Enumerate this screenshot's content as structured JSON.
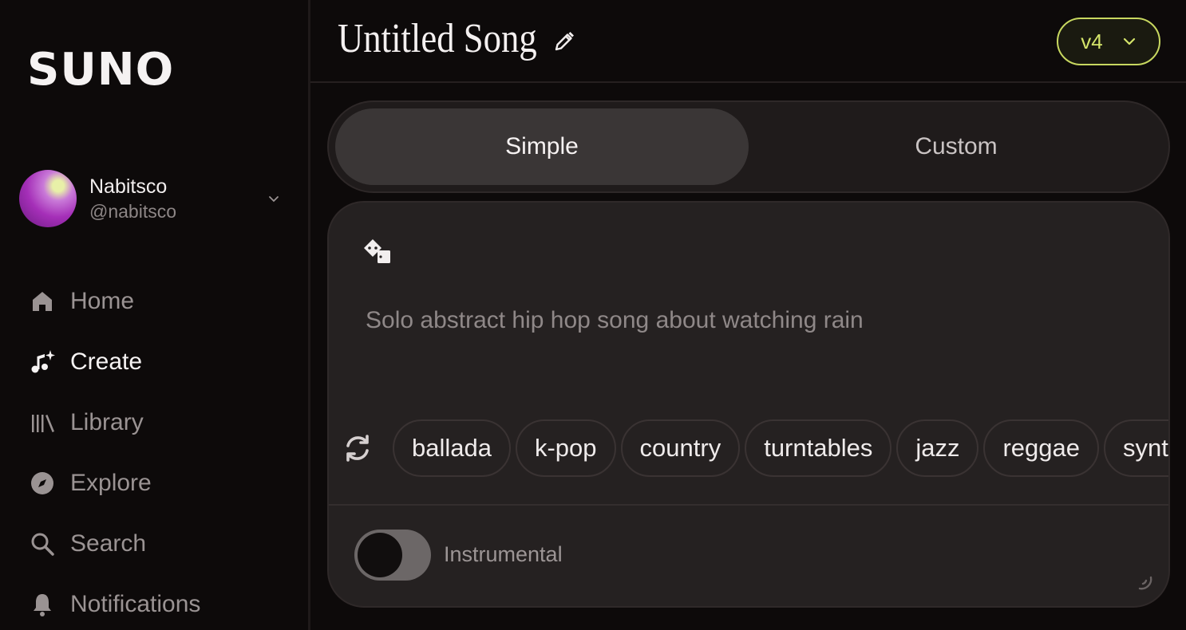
{
  "brand": {
    "logo_text": "SUNO"
  },
  "profile": {
    "name": "Nabitsco",
    "handle": "@nabitsco"
  },
  "nav": {
    "items": [
      {
        "label": "Home",
        "icon": "home-icon",
        "active": false
      },
      {
        "label": "Create",
        "icon": "music-sparkle-icon",
        "active": true
      },
      {
        "label": "Library",
        "icon": "library-icon",
        "active": false
      },
      {
        "label": "Explore",
        "icon": "compass-icon",
        "active": false
      },
      {
        "label": "Search",
        "icon": "search-icon",
        "active": false
      },
      {
        "label": "Notifications",
        "icon": "bell-icon",
        "active": false
      }
    ]
  },
  "header": {
    "title": "Untitled Song",
    "edit_icon": "pencil-icon",
    "version": "v4"
  },
  "mode": {
    "simple_label": "Simple",
    "custom_label": "Custom",
    "selected": "Simple"
  },
  "prompt": {
    "placeholder": "Solo abstract hip hop song about watching rain",
    "value": ""
  },
  "tags": [
    "ballada",
    "k-pop",
    "country",
    "turntables",
    "jazz",
    "reggae",
    "synth"
  ],
  "instrumental": {
    "label": "Instrumental",
    "enabled": false
  },
  "colors": {
    "background": "#0d0a0a",
    "card": "#252121",
    "accent": "#d4e46a",
    "text_muted": "#9a9393"
  }
}
